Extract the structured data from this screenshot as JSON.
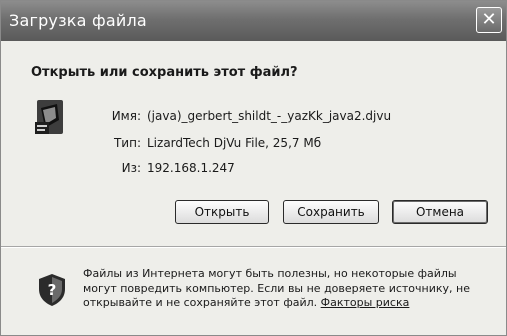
{
  "window": {
    "title": "Загрузка файла"
  },
  "dialog": {
    "question": "Открыть или сохранить этот файл?",
    "file": {
      "name_label": "Имя:",
      "name_value": "(java)_gerbert_shildt_-_yazKk_java2.djvu",
      "type_label": "Тип:",
      "type_value": "LizardTech DjVu File, 25,7 Мб",
      "from_label": "Из:",
      "from_value": "192.168.1.247"
    },
    "buttons": {
      "open": "Открыть",
      "save": "Сохранить",
      "cancel": "Отмена"
    },
    "warning": {
      "text": "Файлы из Интернета могут быть полезны, но некоторые файлы могут повредить компьютер. Если вы не доверяете источнику, не открывайте и не сохраняйте этот файл.",
      "link": "Факторы риска"
    }
  },
  "icons": {
    "close": "close-icon",
    "file": "djvu-file-icon",
    "shield": "shield-question-icon"
  }
}
